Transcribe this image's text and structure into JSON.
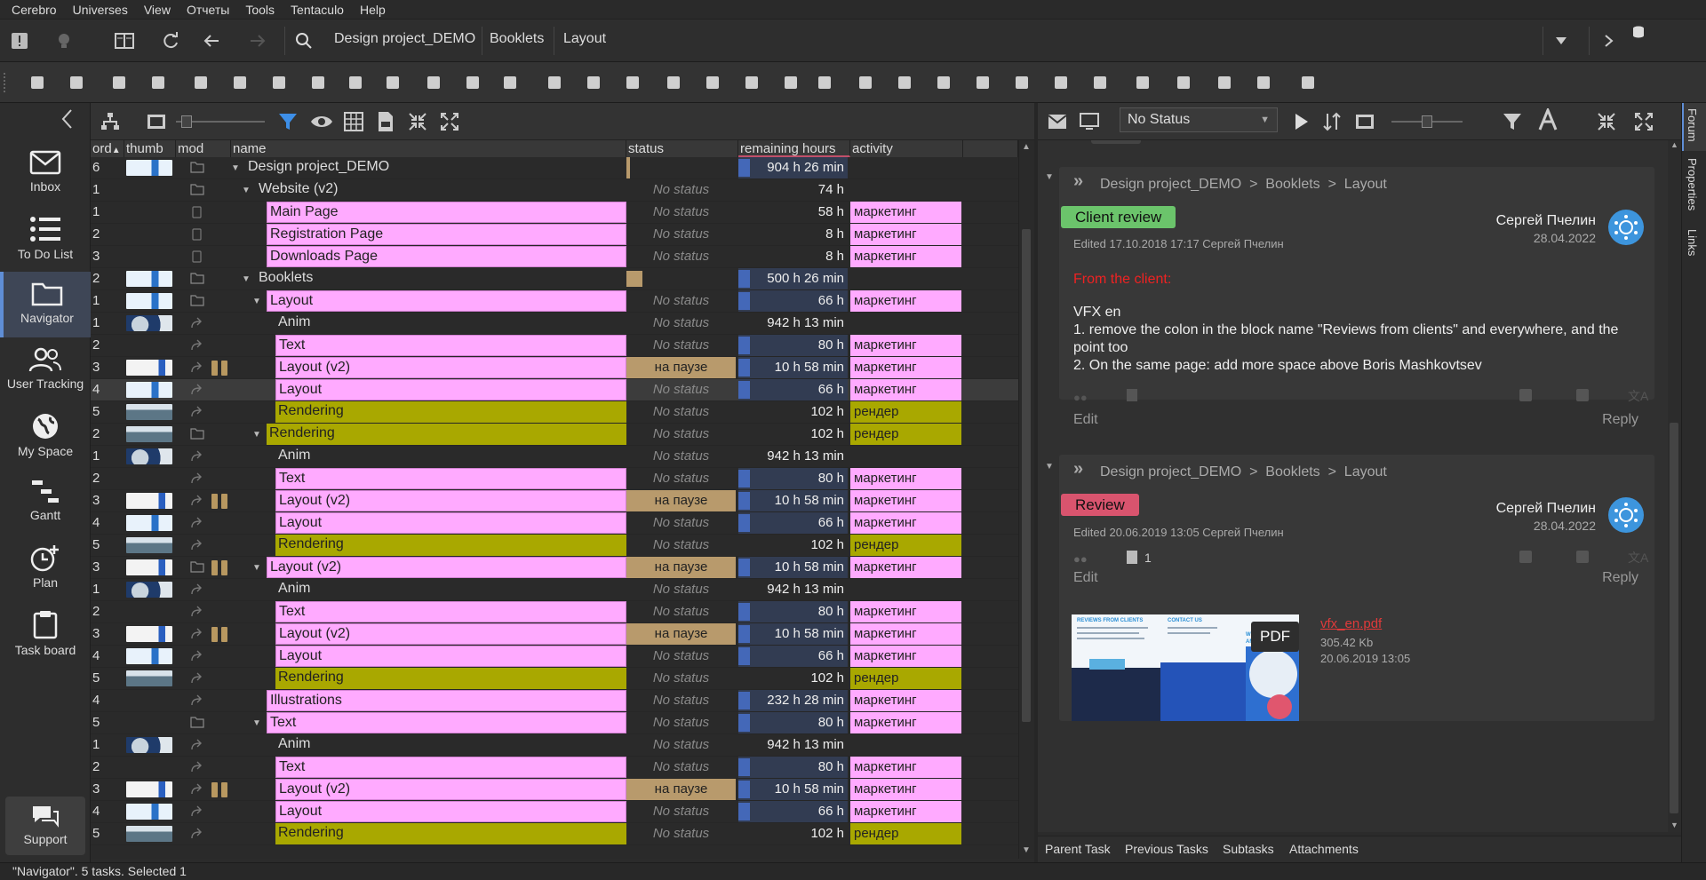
{
  "menu": [
    "Cerebro",
    "Universes",
    "View",
    "Отчеты",
    "Tools",
    "Tentaculo",
    "Help"
  ],
  "breadcrumbs": [
    "Design project_DEMO",
    "Booklets",
    "Layout"
  ],
  "nav": [
    "Inbox",
    "To Do List",
    "Navigator",
    "User Tracking",
    "My Space",
    "Gantt",
    "Plan",
    "Task board"
  ],
  "support": "Support",
  "columns": {
    "ord": "ord",
    "thumb": "thumb",
    "mod": "mod",
    "name": "name",
    "status": "status",
    "hours": "remaining hours",
    "activity": "activity"
  },
  "rows": [
    {
      "ord": "6",
      "name": "Design project_DEMO",
      "indent": 0,
      "expand": "open",
      "color": "none",
      "status": "",
      "hours": "904 h 26 min",
      "hbar": true,
      "activity": "",
      "thumb": "blue",
      "mod": "folder"
    },
    {
      "ord": "1",
      "name": "Website (v2)",
      "indent": 1,
      "expand": "open",
      "color": "none",
      "status": "No status",
      "hours": "74 h",
      "hbar": false,
      "activity": "",
      "thumb": "",
      "mod": "folder"
    },
    {
      "ord": "1",
      "name": "Main Page",
      "indent": 2,
      "expand": "",
      "color": "pink",
      "status": "No status",
      "hours": "58 h",
      "hbar": false,
      "activity": "маркетинг",
      "thumb": "",
      "mod": "page"
    },
    {
      "ord": "2",
      "name": "Registration Page",
      "indent": 2,
      "expand": "",
      "color": "pink",
      "status": "No status",
      "hours": "8 h",
      "hbar": false,
      "activity": "маркетинг",
      "thumb": "",
      "mod": "page"
    },
    {
      "ord": "3",
      "name": "Downloads Page",
      "indent": 2,
      "expand": "",
      "color": "pink",
      "status": "No status",
      "hours": "8 h",
      "hbar": false,
      "activity": "маркетинг",
      "thumb": "",
      "mod": "page"
    },
    {
      "ord": "2",
      "name": "Booklets",
      "indent": 1,
      "expand": "open",
      "color": "none",
      "status": "",
      "hours": "500 h 26 min",
      "hbar": true,
      "activity": "",
      "thumb": "blue",
      "mod": "folder"
    },
    {
      "ord": "1",
      "name": "Layout",
      "indent": 2,
      "expand": "open",
      "color": "pink",
      "status": "No status",
      "hours": "66 h",
      "hbar": true,
      "activity": "маркетинг",
      "thumb": "blue",
      "mod": "folder"
    },
    {
      "ord": "1",
      "name": "Anim",
      "indent": 3,
      "expand": "",
      "color": "none",
      "status": "No status",
      "hours": "942 h 13 min",
      "hbar": false,
      "activity": "",
      "thumb": "wave",
      "mod": "link"
    },
    {
      "ord": "2",
      "name": "Text",
      "indent": 3,
      "expand": "",
      "color": "pink",
      "status": "No status",
      "hours": "80 h",
      "hbar": true,
      "activity": "маркетинг",
      "thumb": "",
      "mod": "link"
    },
    {
      "ord": "3",
      "name": "Layout (v2)",
      "indent": 3,
      "expand": "",
      "color": "pink",
      "status": "на паузе",
      "hours": "10 h 58 min",
      "hbar": true,
      "activity": "маркетинг",
      "thumb": "white",
      "mod": "link-bars"
    },
    {
      "ord": "4",
      "name": "Layout",
      "indent": 3,
      "expand": "",
      "color": "pink",
      "status": "No status",
      "hours": "66 h",
      "hbar": true,
      "activity": "маркетинг",
      "thumb": "blue",
      "mod": "link",
      "selected": true
    },
    {
      "ord": "5",
      "name": "Rendering",
      "indent": 3,
      "expand": "",
      "color": "olive",
      "status": "No status",
      "hours": "102 h",
      "hbar": false,
      "activity": "рендер",
      "thumb": "city",
      "mod": "link"
    },
    {
      "ord": "2",
      "name": "Rendering",
      "indent": 2,
      "expand": "open",
      "color": "olive",
      "status": "No status",
      "hours": "102 h",
      "hbar": false,
      "activity": "рендер",
      "thumb": "city",
      "mod": "folder"
    },
    {
      "ord": "1",
      "name": "Anim",
      "indent": 3,
      "expand": "",
      "color": "none",
      "status": "No status",
      "hours": "942 h 13 min",
      "hbar": false,
      "activity": "",
      "thumb": "wave",
      "mod": "link"
    },
    {
      "ord": "2",
      "name": "Text",
      "indent": 3,
      "expand": "",
      "color": "pink",
      "status": "No status",
      "hours": "80 h",
      "hbar": true,
      "activity": "маркетинг",
      "thumb": "",
      "mod": "link"
    },
    {
      "ord": "3",
      "name": "Layout (v2)",
      "indent": 3,
      "expand": "",
      "color": "pink",
      "status": "на паузе",
      "hours": "10 h 58 min",
      "hbar": true,
      "activity": "маркетинг",
      "thumb": "white",
      "mod": "link-bars"
    },
    {
      "ord": "4",
      "name": "Layout",
      "indent": 3,
      "expand": "",
      "color": "pink",
      "status": "No status",
      "hours": "66 h",
      "hbar": true,
      "activity": "маркетинг",
      "thumb": "blue",
      "mod": "link"
    },
    {
      "ord": "5",
      "name": "Rendering",
      "indent": 3,
      "expand": "",
      "color": "olive",
      "status": "No status",
      "hours": "102 h",
      "hbar": false,
      "activity": "рендер",
      "thumb": "city",
      "mod": "link"
    },
    {
      "ord": "3",
      "name": "Layout (v2)",
      "indent": 2,
      "expand": "open",
      "color": "pink",
      "status": "на паузе",
      "hours": "10 h 58 min",
      "hbar": true,
      "activity": "маркетинг",
      "thumb": "white",
      "mod": "folder-bars"
    },
    {
      "ord": "1",
      "name": "Anim",
      "indent": 3,
      "expand": "",
      "color": "none",
      "status": "No status",
      "hours": "942 h 13 min",
      "hbar": false,
      "activity": "",
      "thumb": "wave",
      "mod": "link"
    },
    {
      "ord": "2",
      "name": "Text",
      "indent": 3,
      "expand": "",
      "color": "pink",
      "status": "No status",
      "hours": "80 h",
      "hbar": true,
      "activity": "маркетинг",
      "thumb": "",
      "mod": "link"
    },
    {
      "ord": "3",
      "name": "Layout (v2)",
      "indent": 3,
      "expand": "",
      "color": "pink",
      "status": "на паузе",
      "hours": "10 h 58 min",
      "hbar": true,
      "activity": "маркетинг",
      "thumb": "white",
      "mod": "link-bars"
    },
    {
      "ord": "4",
      "name": "Layout",
      "indent": 3,
      "expand": "",
      "color": "pink",
      "status": "No status",
      "hours": "66 h",
      "hbar": true,
      "activity": "маркетинг",
      "thumb": "blue",
      "mod": "link"
    },
    {
      "ord": "5",
      "name": "Rendering",
      "indent": 3,
      "expand": "",
      "color": "olive",
      "status": "No status",
      "hours": "102 h",
      "hbar": false,
      "activity": "рендер",
      "thumb": "city",
      "mod": "link"
    },
    {
      "ord": "4",
      "name": "Illustrations",
      "indent": 2,
      "expand": "",
      "color": "pink",
      "status": "No status",
      "hours": "232 h 28 min",
      "hbar": true,
      "activity": "маркетинг",
      "thumb": "",
      "mod": "link"
    },
    {
      "ord": "5",
      "name": "Text",
      "indent": 2,
      "expand": "open",
      "color": "pink",
      "status": "No status",
      "hours": "80 h",
      "hbar": true,
      "activity": "маркетинг",
      "thumb": "",
      "mod": "folder"
    },
    {
      "ord": "1",
      "name": "Anim",
      "indent": 3,
      "expand": "",
      "color": "none",
      "status": "No status",
      "hours": "942 h 13 min",
      "hbar": false,
      "activity": "",
      "thumb": "wave",
      "mod": "link"
    },
    {
      "ord": "2",
      "name": "Text",
      "indent": 3,
      "expand": "",
      "color": "pink",
      "status": "No status",
      "hours": "80 h",
      "hbar": true,
      "activity": "маркетинг",
      "thumb": "",
      "mod": "link"
    },
    {
      "ord": "3",
      "name": "Layout (v2)",
      "indent": 3,
      "expand": "",
      "color": "pink",
      "status": "на паузе",
      "hours": "10 h 58 min",
      "hbar": true,
      "activity": "маркетинг",
      "thumb": "white",
      "mod": "link-bars"
    },
    {
      "ord": "4",
      "name": "Layout",
      "indent": 3,
      "expand": "",
      "color": "pink",
      "status": "No status",
      "hours": "66 h",
      "hbar": true,
      "activity": "маркетинг",
      "thumb": "blue",
      "mod": "link"
    },
    {
      "ord": "5",
      "name": "Rendering",
      "indent": 3,
      "expand": "",
      "color": "olive",
      "status": "No status",
      "hours": "102 h",
      "hbar": false,
      "activity": "рендер",
      "thumb": "city",
      "mod": "link"
    }
  ],
  "forum_toolbar": {
    "status_select": "No Status"
  },
  "posts": [
    {
      "crumbs": [
        "Design project_DEMO",
        "Booklets",
        "Layout"
      ],
      "tag": "Client review",
      "tag_color": "#6bc46b",
      "author": "Сергей Пчелин",
      "date": "28.04.2022",
      "edited": "Edited 17.10.2018 17:17   Сергей Пчелин",
      "body_red": "From the client:",
      "body": [
        "VFX en",
        "1. remove the colon in the block name \"Reviews from clients\" and everywhere, and the point too",
        "2. On the same page: add more space above Boris Mashkovtsev"
      ],
      "edit": "Edit",
      "reply": "Reply"
    },
    {
      "crumbs": [
        "Design project_DEMO",
        "Booklets",
        "Layout"
      ],
      "tag": "Review",
      "tag_color": "#d9546e",
      "author": "Сергей Пчелин",
      "date": "28.04.2022",
      "edited": "Edited 20.06.2019 13:05   Сергей Пчелин",
      "attach_count": "1",
      "edit": "Edit",
      "reply": "Reply",
      "file": {
        "badge": "PDF",
        "name": "vfx_en.pdf",
        "size": "305.42 Kb",
        "date": "20.06.2019 13:05",
        "thumb_texts": [
          "REVIEWS FROM CLIENTS",
          "CONTACT US",
          "WE HELP",
          "AMAZING"
        ]
      }
    }
  ],
  "forum_tabs": [
    "Parent Task",
    "Previous Tasks",
    "Subtasks",
    "Attachments"
  ],
  "right_tabs": [
    "Forum",
    "Properties",
    "Links"
  ],
  "statusbar": "\"Navigator\". 5 tasks. Selected 1",
  "colors": {
    "pink": "#ffaaff",
    "olive": "#a9a800",
    "pause": "#b89a6c",
    "accent": "#5f8ed6",
    "hours_bar": "#4468b8"
  }
}
